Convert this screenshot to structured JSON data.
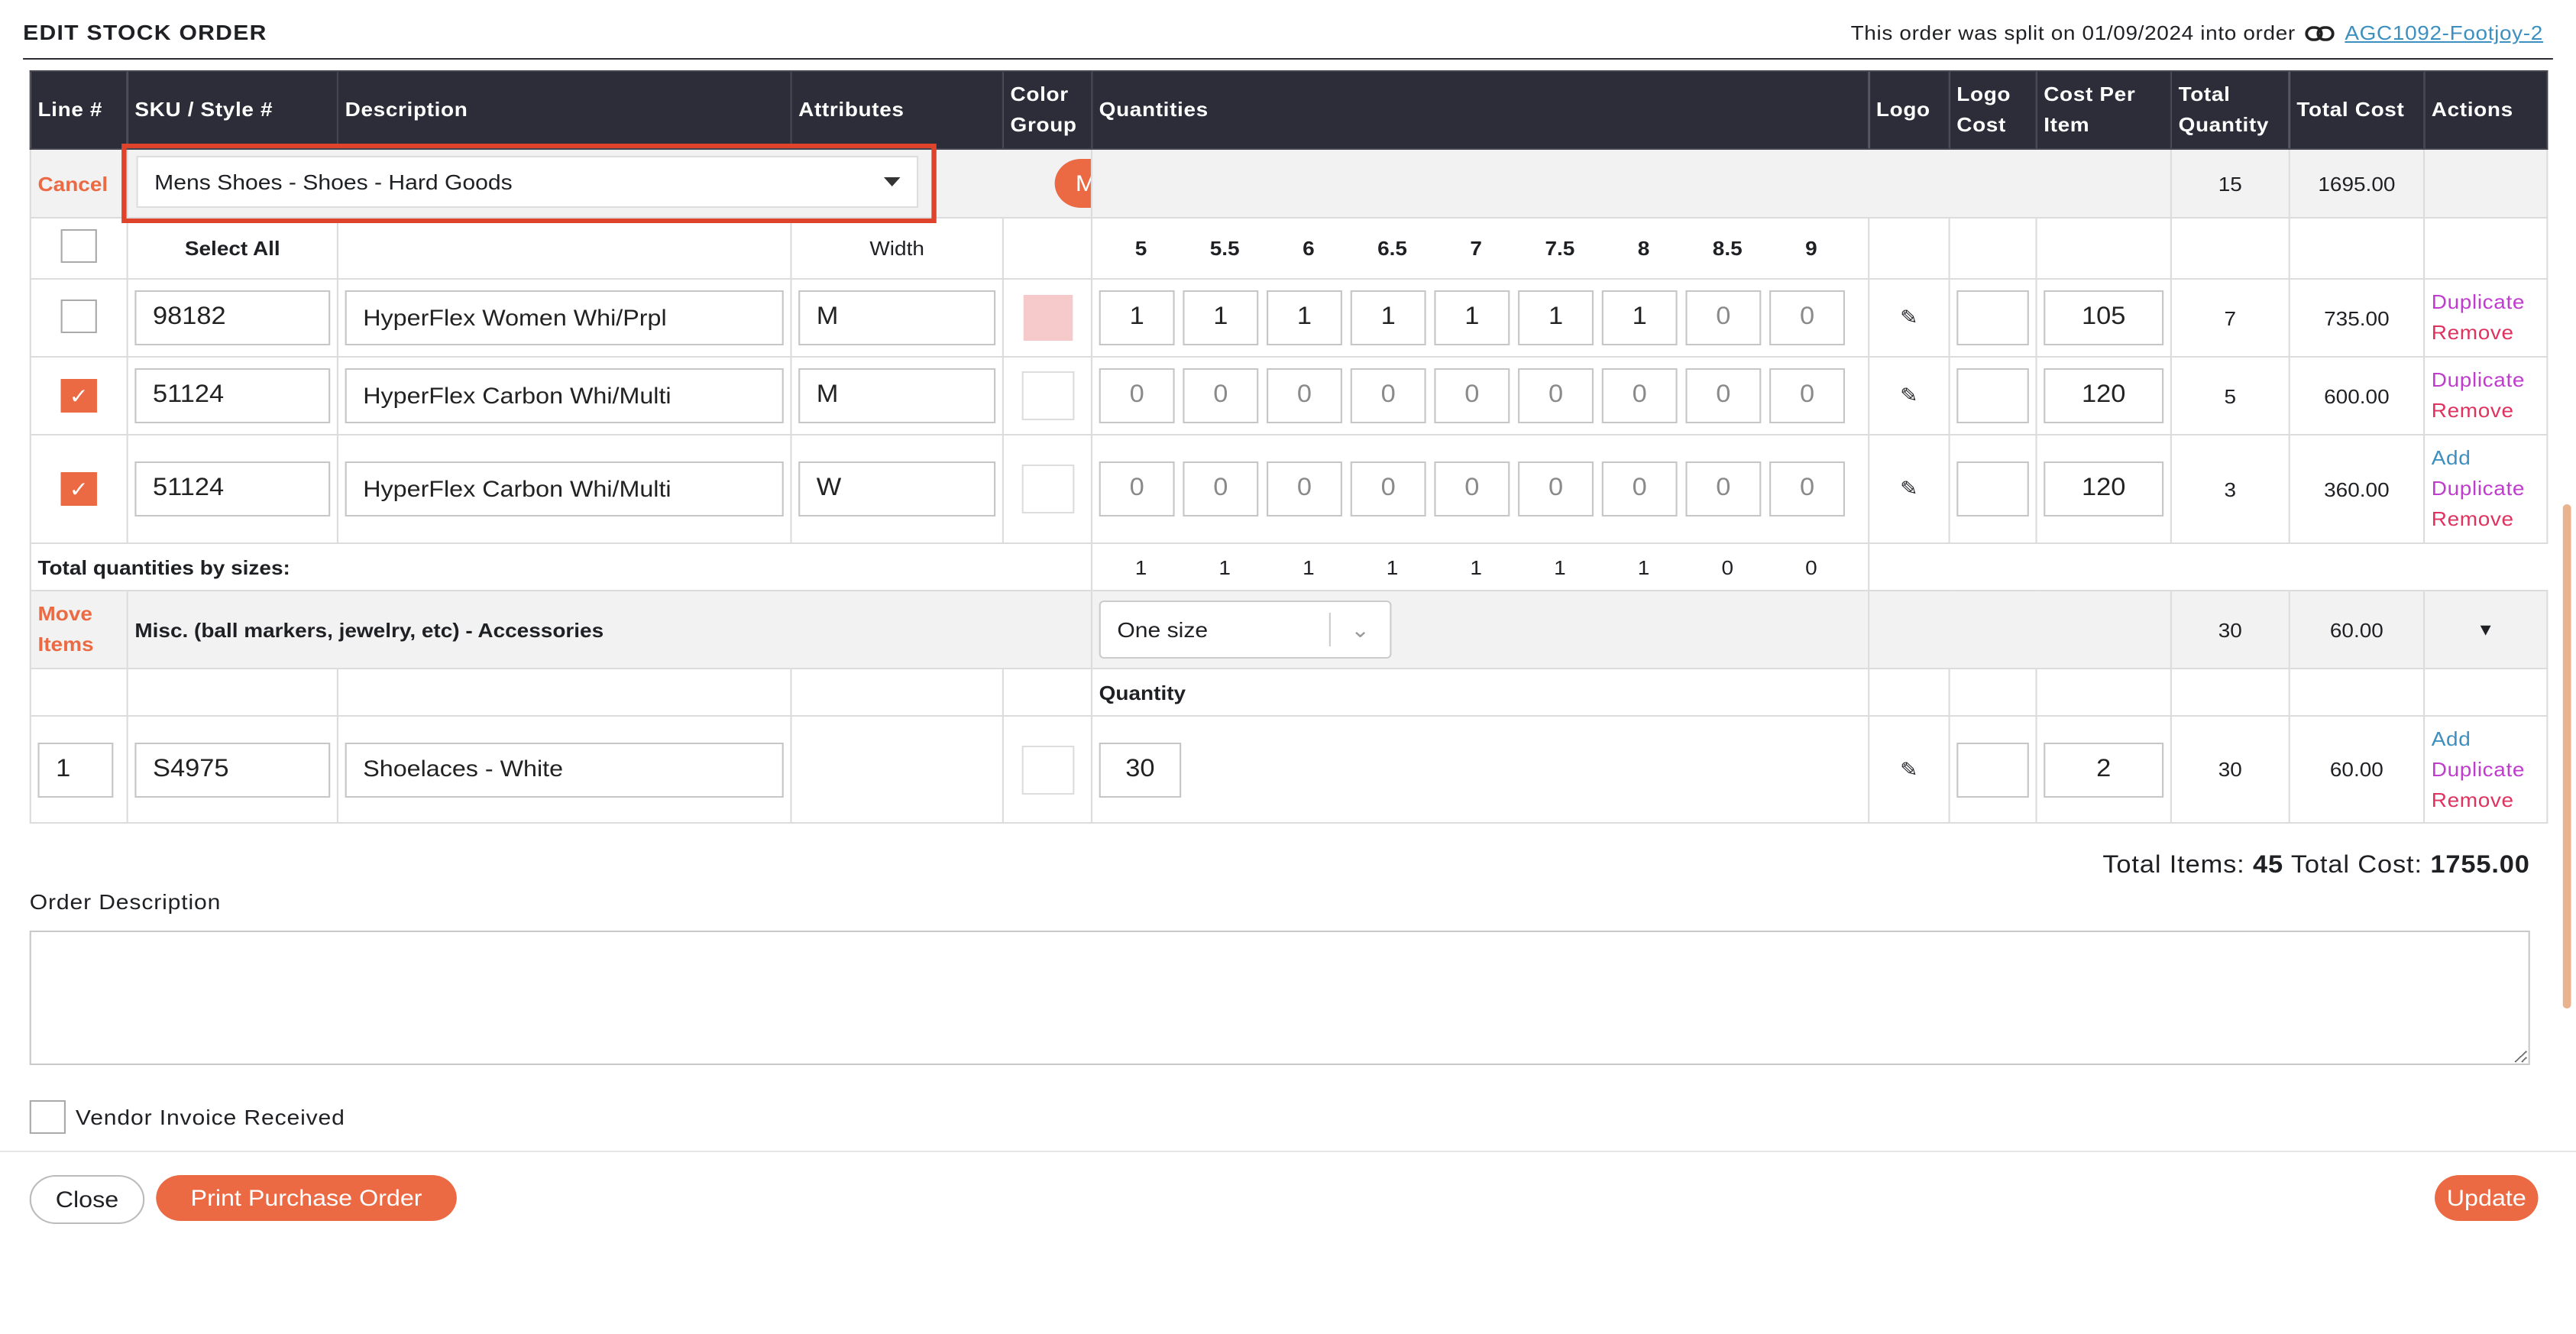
{
  "header": {
    "title": "EDIT STOCK ORDER",
    "split_text": "This order was split on 01/09/2024 into order",
    "split_link": "AGC1092-Footjoy-2"
  },
  "columns": [
    "Line #",
    "SKU / Style #",
    "Description",
    "Attributes",
    "Color Group",
    "Quantities",
    "Logo",
    "Logo Cost",
    "Cost Per Item",
    "Total Quantity",
    "Total Cost",
    "Actions"
  ],
  "group1": {
    "cancel": "Cancel",
    "select_value": "Mens Shoes - Shoes - Hard Goods",
    "move_button": "Move",
    "total_qty": "15",
    "total_cost": "1695.00",
    "select_all": "Select All",
    "width_label": "Width",
    "sizes": [
      "5",
      "5.5",
      "6",
      "6.5",
      "7",
      "7.5",
      "8",
      "8.5",
      "9"
    ],
    "rows": [
      {
        "checked": false,
        "sku": "98182",
        "description": "HyperFlex Women Whi/Prpl",
        "width": "M",
        "qty": [
          "1",
          "1",
          "1",
          "1",
          "1",
          "1",
          "1",
          "0",
          "0"
        ],
        "cost": "105",
        "total_qty": "7",
        "total_cost": "735.00",
        "actions": [
          "Duplicate",
          "Remove"
        ]
      },
      {
        "checked": true,
        "sku": "51124",
        "description": "HyperFlex Carbon Whi/Multi",
        "width": "M",
        "qty": [
          "0",
          "0",
          "0",
          "0",
          "0",
          "0",
          "0",
          "0",
          "0"
        ],
        "cost": "120",
        "total_qty": "5",
        "total_cost": "600.00",
        "actions": [
          "Duplicate",
          "Remove"
        ]
      },
      {
        "checked": true,
        "sku": "51124",
        "description": "HyperFlex Carbon Whi/Multi",
        "width": "W",
        "qty": [
          "0",
          "0",
          "0",
          "0",
          "0",
          "0",
          "0",
          "0",
          "0"
        ],
        "cost": "120",
        "total_qty": "3",
        "total_cost": "360.00",
        "actions": [
          "Add",
          "Duplicate",
          "Remove"
        ]
      }
    ],
    "totals_label": "Total quantities by sizes:",
    "size_totals": [
      "1",
      "1",
      "1",
      "1",
      "1",
      "1",
      "1",
      "0",
      "0"
    ]
  },
  "group2": {
    "move_items": "Move Items",
    "name": "Misc. (ball markers, jewelry, etc) - Accessories",
    "size_select": "One size",
    "total_qty": "30",
    "total_cost": "60.00",
    "quantity_label": "Quantity",
    "row": {
      "line": "1",
      "sku": "S4975",
      "description": "Shoelaces - White",
      "qty": "30",
      "cost": "2",
      "total_qty": "30",
      "total_cost": "60.00",
      "actions": [
        "Add",
        "Duplicate",
        "Remove"
      ]
    }
  },
  "summary": {
    "items_label": "Total Items:",
    "items": "45",
    "cost_label": "Total Cost:",
    "cost": "1755.00"
  },
  "order_description_label": "Order Description",
  "vendor_invoice_label": "Vendor Invoice Received",
  "buttons": {
    "close": "Close",
    "print": "Print Purchase Order",
    "update": "Update"
  },
  "colors": {
    "accent": "#ec6a43",
    "header_bg": "#2c2d38",
    "highlight": "#e0432c",
    "swatch_pink": "#f6caca"
  }
}
